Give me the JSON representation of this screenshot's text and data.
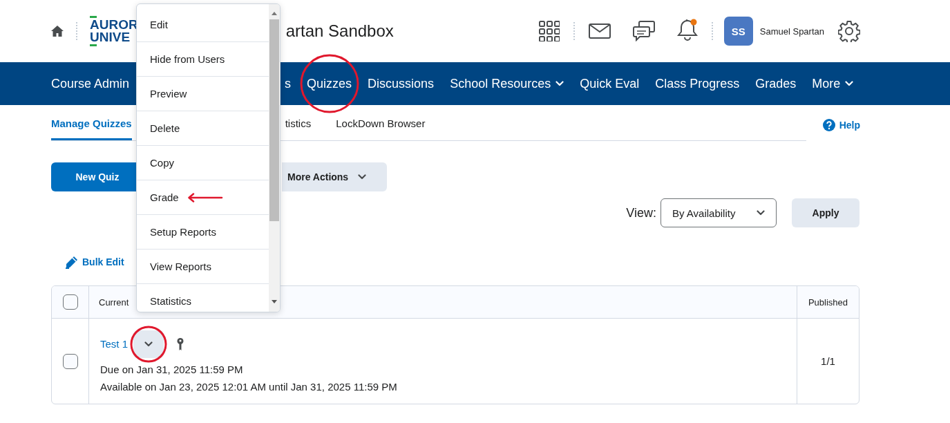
{
  "header": {
    "logo_lines": [
      "AUROR",
      "UNIVE"
    ],
    "course_title": "artan Sandbox",
    "notifications_unread": true,
    "user": {
      "initials": "SS",
      "name": "Samuel Spartan"
    }
  },
  "nav": [
    {
      "label": "Course Admin",
      "dropdown": false,
      "circled": false
    },
    {
      "label": "s",
      "dropdown": false,
      "circled": false
    },
    {
      "label": "Quizzes",
      "dropdown": false,
      "circled": true
    },
    {
      "label": "Discussions",
      "dropdown": false,
      "circled": false
    },
    {
      "label": "School Resources",
      "dropdown": true,
      "circled": false
    },
    {
      "label": "Quick Eval",
      "dropdown": false,
      "circled": false
    },
    {
      "label": "Class Progress",
      "dropdown": false,
      "circled": false
    },
    {
      "label": "Grades",
      "dropdown": false,
      "circled": false
    },
    {
      "label": "More",
      "dropdown": true,
      "circled": false
    }
  ],
  "tabs": [
    {
      "label": "Manage Quizzes",
      "selected": true
    },
    {
      "label": "tistics",
      "selected": false
    },
    {
      "label": "LockDown Browser",
      "selected": false
    }
  ],
  "help": "Help",
  "buttons": {
    "new": "New Quiz",
    "more": "More Actions"
  },
  "view": {
    "label": "View:",
    "value": "By Availability",
    "apply": "Apply"
  },
  "bulk_edit": "Bulk Edit",
  "table": {
    "header": {
      "checked": false,
      "column_2": "Current",
      "column_3": "Published"
    },
    "rows": [
      {
        "checked": false,
        "title": "Test 1",
        "menu_circled": true,
        "due": "Due on Jan 31, 2025 11:59 PM",
        "available": "Available on Jan 23, 2025 12:01 AM until Jan 31, 2025 11:59 PM",
        "published": "1/1"
      }
    ]
  },
  "context_menu": [
    {
      "label": "Edit",
      "marked": false
    },
    {
      "label": "Hide from Users",
      "marked": false
    },
    {
      "label": "Preview",
      "marked": false
    },
    {
      "label": "Delete",
      "marked": false
    },
    {
      "label": "Copy",
      "marked": false
    },
    {
      "label": "Grade",
      "marked": true
    },
    {
      "label": "Setup Reports",
      "marked": false
    },
    {
      "label": "View Reports",
      "marked": false
    },
    {
      "label": "Statistics",
      "marked": false
    }
  ]
}
